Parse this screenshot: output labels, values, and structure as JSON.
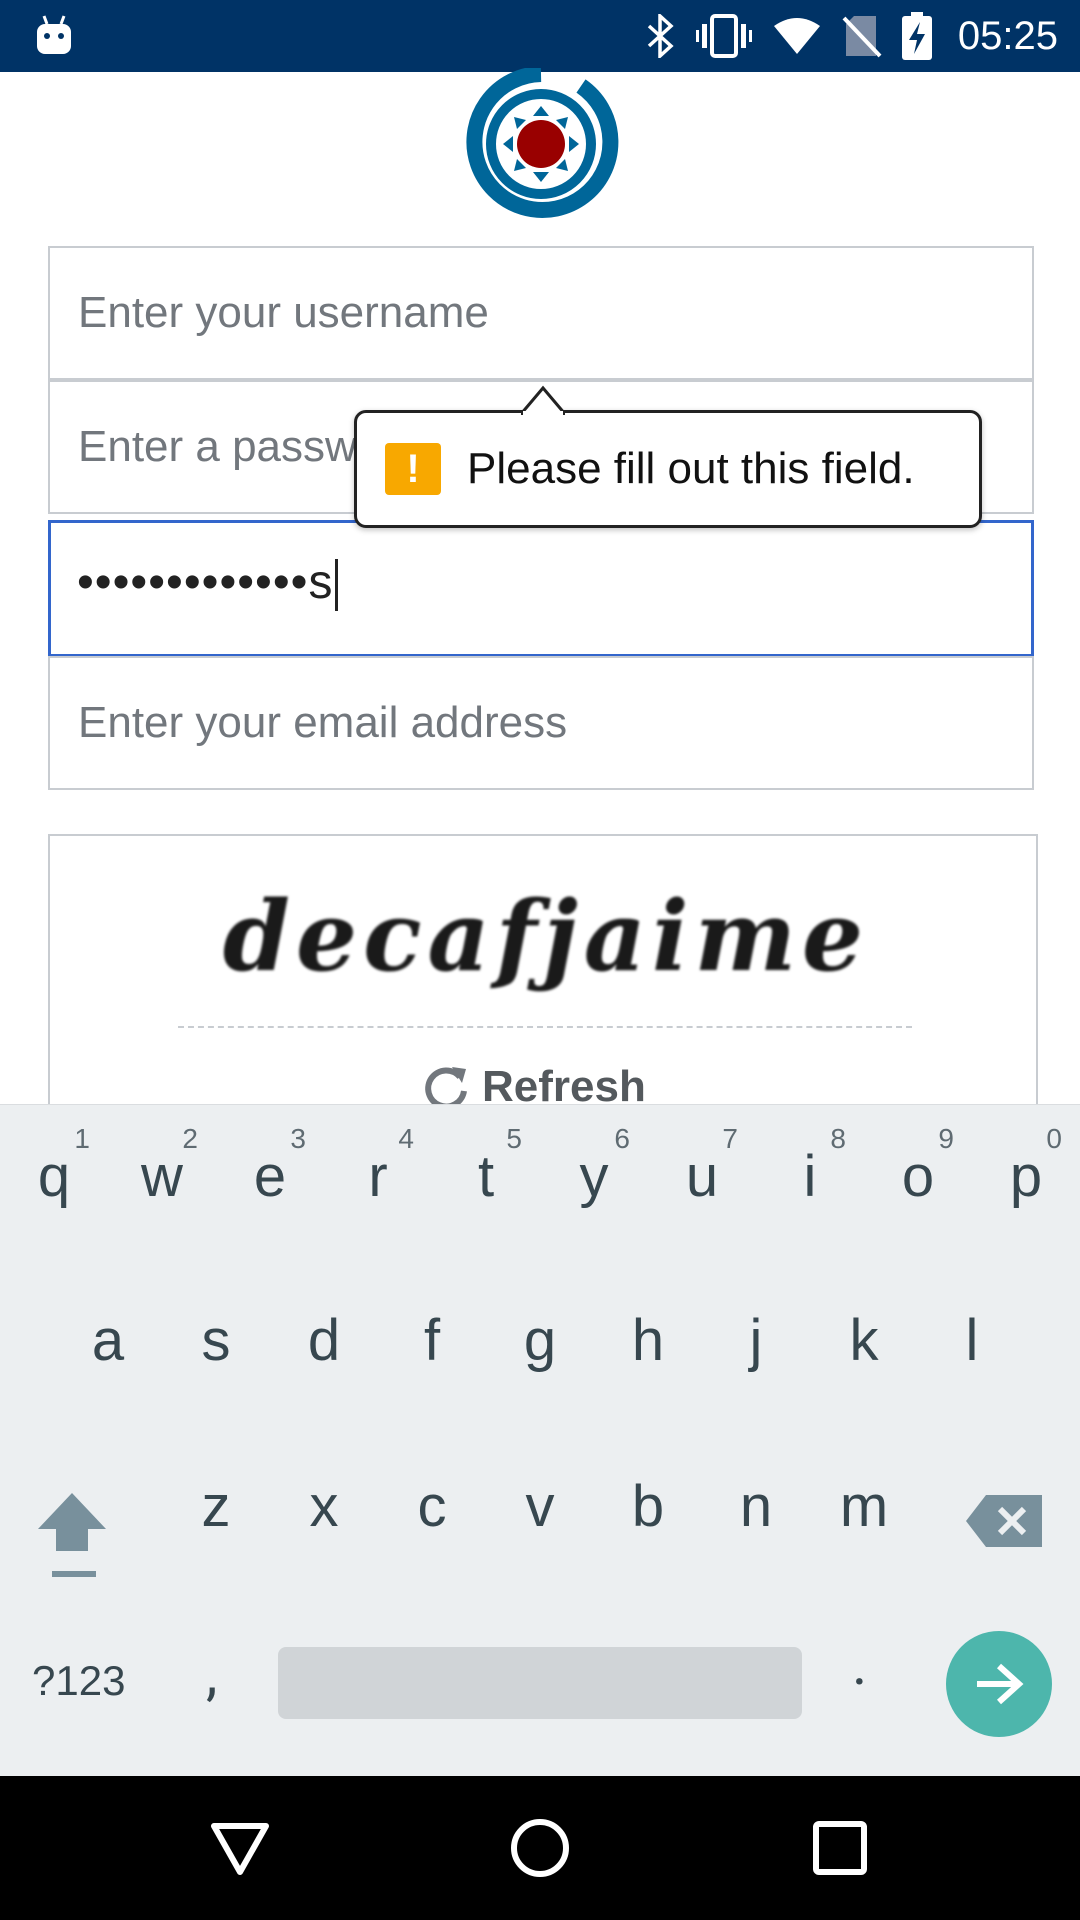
{
  "status_bar": {
    "time": "05:25",
    "icons": [
      "android-icon",
      "bluetooth-icon",
      "vibrate-icon",
      "wifi-icon",
      "no-sim-icon",
      "battery-charging-icon"
    ]
  },
  "form": {
    "username_placeholder": "Enter your username",
    "password_placeholder": "Enter a password",
    "password_confirm_value": "•••••••••••••s",
    "email_placeholder": "Enter your email address"
  },
  "tooltip": {
    "icon": "!",
    "message": "Please fill out this field."
  },
  "captcha": {
    "text": "decafjaime",
    "refresh_label": "Refresh"
  },
  "keyboard": {
    "row1": [
      {
        "key": "q",
        "hint": "1"
      },
      {
        "key": "w",
        "hint": "2"
      },
      {
        "key": "e",
        "hint": "3"
      },
      {
        "key": "r",
        "hint": "4"
      },
      {
        "key": "t",
        "hint": "5"
      },
      {
        "key": "y",
        "hint": "6"
      },
      {
        "key": "u",
        "hint": "7"
      },
      {
        "key": "i",
        "hint": "8"
      },
      {
        "key": "o",
        "hint": "9"
      },
      {
        "key": "p",
        "hint": "0"
      }
    ],
    "row2": [
      "a",
      "s",
      "d",
      "f",
      "g",
      "h",
      "j",
      "k",
      "l"
    ],
    "row3": [
      "z",
      "x",
      "c",
      "v",
      "b",
      "n",
      "m"
    ],
    "symbols_label": "?123",
    "comma_label": ",",
    "period_label": ".",
    "accent_color": "#4db6ac"
  }
}
